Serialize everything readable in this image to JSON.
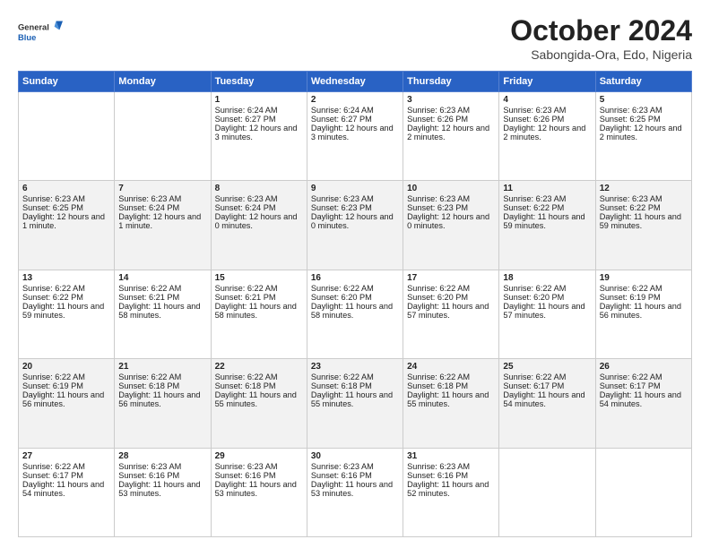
{
  "header": {
    "logo_general": "General",
    "logo_blue": "Blue",
    "month_title": "October 2024",
    "location": "Sabongida-Ora, Edo, Nigeria"
  },
  "weekdays": [
    "Sunday",
    "Monday",
    "Tuesday",
    "Wednesday",
    "Thursday",
    "Friday",
    "Saturday"
  ],
  "weeks": [
    [
      {
        "day": "",
        "info": ""
      },
      {
        "day": "",
        "info": ""
      },
      {
        "day": "1",
        "info": "Sunrise: 6:24 AM\nSunset: 6:27 PM\nDaylight: 12 hours and 3 minutes."
      },
      {
        "day": "2",
        "info": "Sunrise: 6:24 AM\nSunset: 6:27 PM\nDaylight: 12 hours and 3 minutes."
      },
      {
        "day": "3",
        "info": "Sunrise: 6:23 AM\nSunset: 6:26 PM\nDaylight: 12 hours and 2 minutes."
      },
      {
        "day": "4",
        "info": "Sunrise: 6:23 AM\nSunset: 6:26 PM\nDaylight: 12 hours and 2 minutes."
      },
      {
        "day": "5",
        "info": "Sunrise: 6:23 AM\nSunset: 6:25 PM\nDaylight: 12 hours and 2 minutes."
      }
    ],
    [
      {
        "day": "6",
        "info": "Sunrise: 6:23 AM\nSunset: 6:25 PM\nDaylight: 12 hours and 1 minute."
      },
      {
        "day": "7",
        "info": "Sunrise: 6:23 AM\nSunset: 6:24 PM\nDaylight: 12 hours and 1 minute."
      },
      {
        "day": "8",
        "info": "Sunrise: 6:23 AM\nSunset: 6:24 PM\nDaylight: 12 hours and 0 minutes."
      },
      {
        "day": "9",
        "info": "Sunrise: 6:23 AM\nSunset: 6:23 PM\nDaylight: 12 hours and 0 minutes."
      },
      {
        "day": "10",
        "info": "Sunrise: 6:23 AM\nSunset: 6:23 PM\nDaylight: 12 hours and 0 minutes."
      },
      {
        "day": "11",
        "info": "Sunrise: 6:23 AM\nSunset: 6:22 PM\nDaylight: 11 hours and 59 minutes."
      },
      {
        "day": "12",
        "info": "Sunrise: 6:23 AM\nSunset: 6:22 PM\nDaylight: 11 hours and 59 minutes."
      }
    ],
    [
      {
        "day": "13",
        "info": "Sunrise: 6:22 AM\nSunset: 6:22 PM\nDaylight: 11 hours and 59 minutes."
      },
      {
        "day": "14",
        "info": "Sunrise: 6:22 AM\nSunset: 6:21 PM\nDaylight: 11 hours and 58 minutes."
      },
      {
        "day": "15",
        "info": "Sunrise: 6:22 AM\nSunset: 6:21 PM\nDaylight: 11 hours and 58 minutes."
      },
      {
        "day": "16",
        "info": "Sunrise: 6:22 AM\nSunset: 6:20 PM\nDaylight: 11 hours and 58 minutes."
      },
      {
        "day": "17",
        "info": "Sunrise: 6:22 AM\nSunset: 6:20 PM\nDaylight: 11 hours and 57 minutes."
      },
      {
        "day": "18",
        "info": "Sunrise: 6:22 AM\nSunset: 6:20 PM\nDaylight: 11 hours and 57 minutes."
      },
      {
        "day": "19",
        "info": "Sunrise: 6:22 AM\nSunset: 6:19 PM\nDaylight: 11 hours and 56 minutes."
      }
    ],
    [
      {
        "day": "20",
        "info": "Sunrise: 6:22 AM\nSunset: 6:19 PM\nDaylight: 11 hours and 56 minutes."
      },
      {
        "day": "21",
        "info": "Sunrise: 6:22 AM\nSunset: 6:18 PM\nDaylight: 11 hours and 56 minutes."
      },
      {
        "day": "22",
        "info": "Sunrise: 6:22 AM\nSunset: 6:18 PM\nDaylight: 11 hours and 55 minutes."
      },
      {
        "day": "23",
        "info": "Sunrise: 6:22 AM\nSunset: 6:18 PM\nDaylight: 11 hours and 55 minutes."
      },
      {
        "day": "24",
        "info": "Sunrise: 6:22 AM\nSunset: 6:18 PM\nDaylight: 11 hours and 55 minutes."
      },
      {
        "day": "25",
        "info": "Sunrise: 6:22 AM\nSunset: 6:17 PM\nDaylight: 11 hours and 54 minutes."
      },
      {
        "day": "26",
        "info": "Sunrise: 6:22 AM\nSunset: 6:17 PM\nDaylight: 11 hours and 54 minutes."
      }
    ],
    [
      {
        "day": "27",
        "info": "Sunrise: 6:22 AM\nSunset: 6:17 PM\nDaylight: 11 hours and 54 minutes."
      },
      {
        "day": "28",
        "info": "Sunrise: 6:23 AM\nSunset: 6:16 PM\nDaylight: 11 hours and 53 minutes."
      },
      {
        "day": "29",
        "info": "Sunrise: 6:23 AM\nSunset: 6:16 PM\nDaylight: 11 hours and 53 minutes."
      },
      {
        "day": "30",
        "info": "Sunrise: 6:23 AM\nSunset: 6:16 PM\nDaylight: 11 hours and 53 minutes."
      },
      {
        "day": "31",
        "info": "Sunrise: 6:23 AM\nSunset: 6:16 PM\nDaylight: 11 hours and 52 minutes."
      },
      {
        "day": "",
        "info": ""
      },
      {
        "day": "",
        "info": ""
      }
    ]
  ]
}
